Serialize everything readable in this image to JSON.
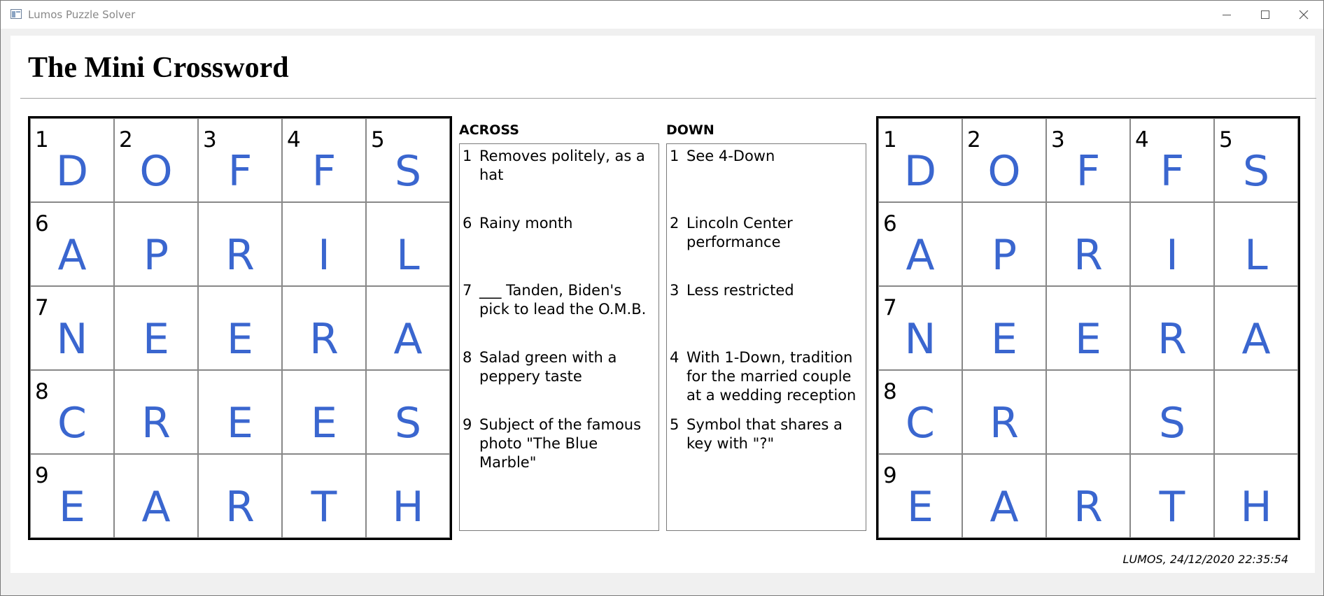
{
  "window": {
    "title": "Lumos Puzzle Solver"
  },
  "page": {
    "heading": "The Mini Crossword",
    "footer": "LUMOS, 24/12/2020 22:35:54"
  },
  "grids": [
    {
      "cells": [
        [
          "1",
          "D"
        ],
        [
          "2",
          "O"
        ],
        [
          "3",
          "F"
        ],
        [
          "4",
          "F"
        ],
        [
          "5",
          "S"
        ],
        [
          "6",
          "A"
        ],
        [
          "",
          "P"
        ],
        [
          "",
          "R"
        ],
        [
          "",
          "I"
        ],
        [
          "",
          "L"
        ],
        [
          "7",
          "N"
        ],
        [
          "",
          "E"
        ],
        [
          "",
          "E"
        ],
        [
          "",
          "R"
        ],
        [
          "",
          "A"
        ],
        [
          "8",
          "C"
        ],
        [
          "",
          "R"
        ],
        [
          "",
          "E"
        ],
        [
          "",
          "E"
        ],
        [
          "",
          "S"
        ],
        [
          "9",
          "E"
        ],
        [
          "",
          "A"
        ],
        [
          "",
          "R"
        ],
        [
          "",
          "T"
        ],
        [
          "",
          "H"
        ]
      ]
    },
    {
      "cells": [
        [
          "1",
          "D"
        ],
        [
          "2",
          "O"
        ],
        [
          "3",
          "F"
        ],
        [
          "4",
          "F"
        ],
        [
          "5",
          "S"
        ],
        [
          "6",
          "A"
        ],
        [
          "",
          "P"
        ],
        [
          "",
          "R"
        ],
        [
          "",
          "I"
        ],
        [
          "",
          "L"
        ],
        [
          "7",
          "N"
        ],
        [
          "",
          "E"
        ],
        [
          "",
          "E"
        ],
        [
          "",
          "R"
        ],
        [
          "",
          "A"
        ],
        [
          "8",
          "C"
        ],
        [
          "",
          "R"
        ],
        [
          "",
          ""
        ],
        [
          "",
          "S"
        ],
        [
          "",
          ""
        ],
        [
          "9",
          "E"
        ],
        [
          "",
          "A"
        ],
        [
          "",
          "R"
        ],
        [
          "",
          "T"
        ],
        [
          "",
          "H"
        ]
      ]
    }
  ],
  "across": {
    "label": "ACROSS",
    "clues": [
      {
        "num": "1",
        "text": "Removes politely, as a hat"
      },
      {
        "num": "6",
        "text": "Rainy month"
      },
      {
        "num": "7",
        "text": "___ Tanden, Biden's pick to lead the O.M.B."
      },
      {
        "num": "8",
        "text": "Salad green with a peppery taste"
      },
      {
        "num": "9",
        "text": "Subject of the famous photo \"The Blue Marble\""
      }
    ]
  },
  "down": {
    "label": "DOWN",
    "clues": [
      {
        "num": "1",
        "text": "See 4-Down"
      },
      {
        "num": "2",
        "text": "Lincoln Center performance"
      },
      {
        "num": "3",
        "text": "Less restricted"
      },
      {
        "num": "4",
        "text": "With 1-Down, tradition for the married couple at a wedding reception"
      },
      {
        "num": "5",
        "text": "Symbol that shares a key with \"?\""
      }
    ]
  },
  "colors": {
    "letter": "#3a66cf",
    "grid_border": "#000000"
  }
}
